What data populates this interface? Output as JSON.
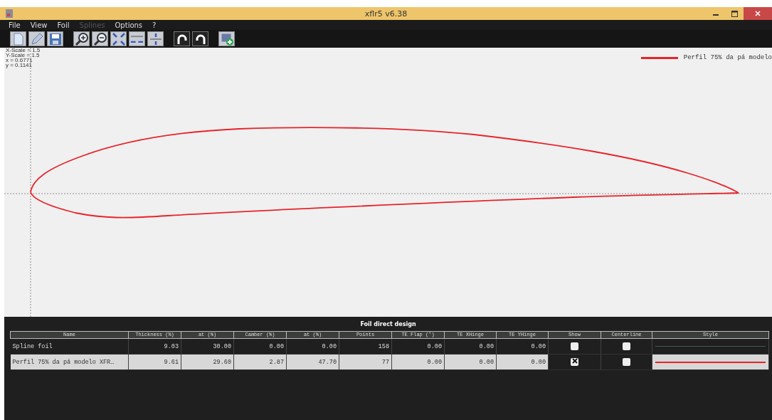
{
  "window": {
    "title": "xflr5 v6.38"
  },
  "menu": [
    {
      "label": "File",
      "disabled": false
    },
    {
      "label": "View",
      "disabled": false
    },
    {
      "label": "Foil",
      "disabled": false
    },
    {
      "label": "Splines",
      "disabled": true
    },
    {
      "label": "Options",
      "disabled": false
    },
    {
      "label": "?",
      "disabled": false
    }
  ],
  "toolbar": [
    {
      "kind": "new"
    },
    {
      "kind": "edit"
    },
    {
      "kind": "save"
    },
    {
      "kind": "sep"
    },
    {
      "kind": "zoom-in"
    },
    {
      "kind": "zoom-out"
    },
    {
      "kind": "reset"
    },
    {
      "kind": "zoom-x"
    },
    {
      "kind": "zoom-y"
    },
    {
      "kind": "sep"
    },
    {
      "kind": "undo"
    },
    {
      "kind": "redo"
    },
    {
      "kind": "sep"
    },
    {
      "kind": "export"
    }
  ],
  "canvas": {
    "readout": [
      "X-Scale = 1.5",
      "Y-Scale = 1.5",
      "x =  0.6771",
      "y =  0.1141"
    ],
    "legend": {
      "label": "Perfil 75% da pá modelo",
      "color": "#e8232a"
    }
  },
  "panel": {
    "title": "Foil direct design",
    "columns": [
      "Name",
      "Thickness (%)",
      "at (%)",
      "Camber (%)",
      "at (%)",
      "Points",
      "TE Flap (°)",
      "TE XHinge",
      "TE YHinge",
      "Show",
      "Centerline",
      "Style"
    ],
    "rows": [
      {
        "selected": false,
        "cells": [
          "Spline foil",
          "9.03",
          "30.00",
          "0.00",
          "0.00",
          "158",
          "0.00",
          "0.00",
          "0.00"
        ],
        "show": false,
        "centerline": false,
        "color": "#4a5a4a"
      },
      {
        "selected": true,
        "cells": [
          "Perfil 75% da pá modelo XFR…",
          "9.61",
          "29.60",
          "2.87",
          "47.70",
          "77",
          "0.00",
          "0.00",
          "0.00"
        ],
        "show": true,
        "centerline": false,
        "color": "#e8232a"
      }
    ]
  }
}
